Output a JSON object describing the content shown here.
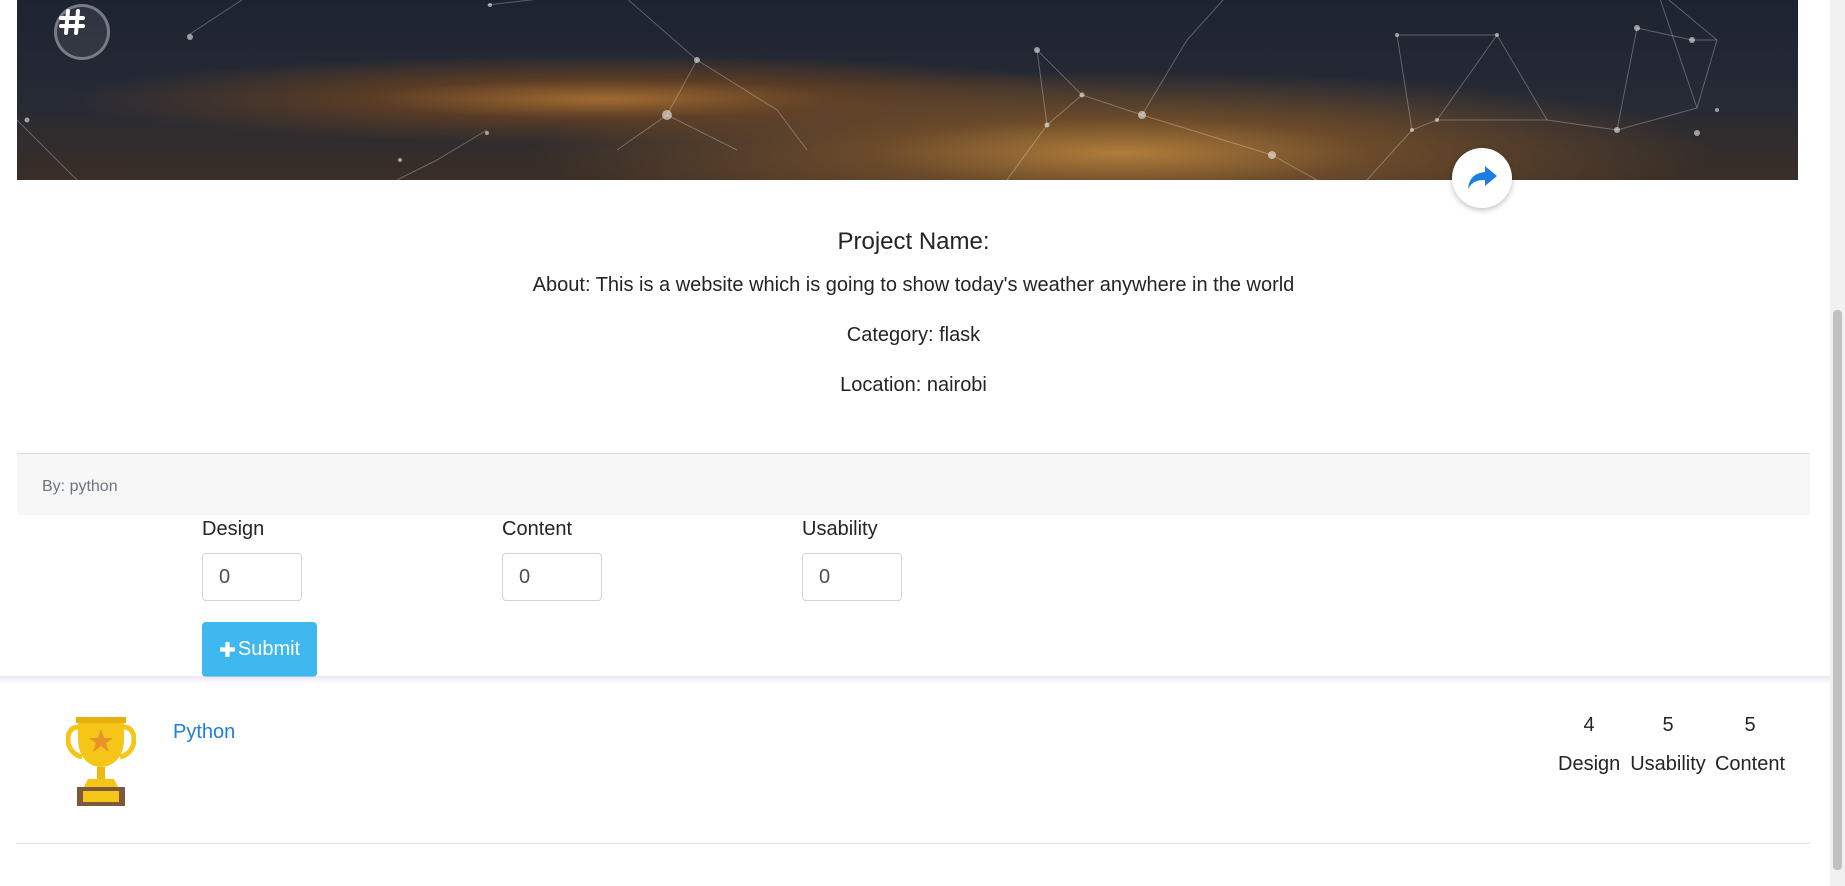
{
  "project": {
    "name_label": "Project Name:",
    "about": "About: This is a website which is going to show today's weather anywhere in the world",
    "category": "Category: flask",
    "location": "Location: nairobi"
  },
  "footer": {
    "author": "By: python"
  },
  "rating_form": {
    "design": {
      "label": "Design",
      "value": "0"
    },
    "content": {
      "label": "Content",
      "value": "0"
    },
    "usability": {
      "label": "Usability",
      "value": "0"
    },
    "submit_label": "Submit"
  },
  "rating_result": {
    "user": "Python",
    "scores": [
      {
        "value": "4",
        "label": "Design"
      },
      {
        "value": "5",
        "label": "Usability"
      },
      {
        "value": "5",
        "label": "Content"
      }
    ]
  },
  "colors": {
    "accent": "#3fb7ef",
    "link": "#1a7fe0",
    "share_icon": "#1a7fe0",
    "trophy": "#f5c518"
  },
  "icons": {
    "hashtag": "hashtag-icon",
    "share": "share-icon",
    "plus": "plus-icon",
    "trophy": "trophy-icon"
  }
}
